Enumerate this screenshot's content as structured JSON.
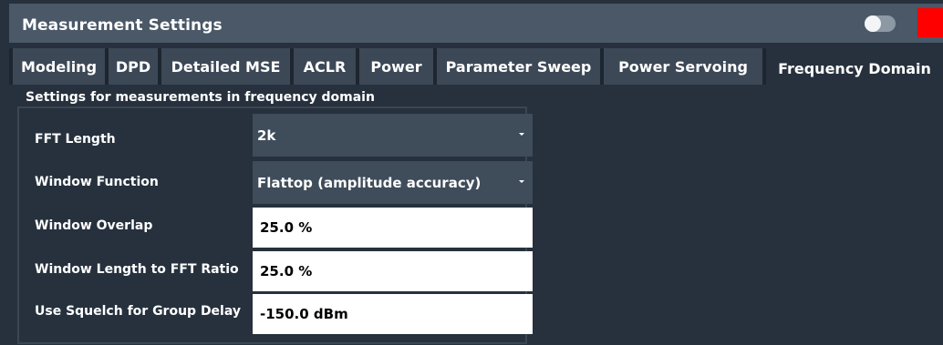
{
  "window": {
    "title": "Measurement Settings"
  },
  "tabs": [
    {
      "label": "Modeling",
      "active": false
    },
    {
      "label": "DPD",
      "active": false
    },
    {
      "label": "Detailed MSE",
      "active": false
    },
    {
      "label": "ACLR",
      "active": false
    },
    {
      "label": "Power",
      "active": false
    },
    {
      "label": "Parameter Sweep",
      "active": false
    },
    {
      "label": "Power Servoing",
      "active": false
    },
    {
      "label": "Frequency Domain",
      "active": true
    }
  ],
  "section": {
    "title": "Settings for measurements in frequency domain"
  },
  "settings": {
    "fft_length": {
      "label": "FFT Length",
      "value": "2k"
    },
    "window_function": {
      "label": "Window Function",
      "value": "Flattop (amplitude accuracy)"
    },
    "window_overlap": {
      "label": "Window Overlap",
      "value": "25.0 %"
    },
    "window_length_ratio": {
      "label": "Window Length to FFT Ratio",
      "value": "25.0 %"
    },
    "squelch_group_delay": {
      "label": "Use Squelch for Group Delay",
      "value": "-150.0 dBm"
    }
  },
  "colors": {
    "background": "#26313d",
    "titlebar": "#4a5867",
    "tab": "#3c4856",
    "input_bg": "#ffffff",
    "close_button": "#ff0000"
  }
}
